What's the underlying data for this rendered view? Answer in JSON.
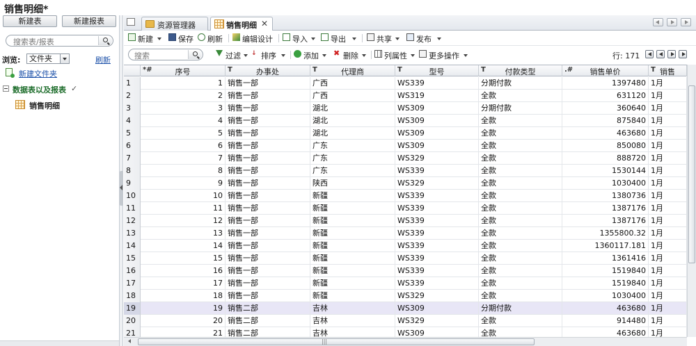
{
  "window": {
    "title": "销售明细*"
  },
  "left": {
    "new_table": "新建表",
    "new_report": "新建报表",
    "search_placeholder": "搜索表/报表",
    "browse_label": "浏览:",
    "browse_value": "文件夹",
    "refresh": "刷新",
    "new_folder": "新建文件夹",
    "tree_root": "数据表以及报表",
    "tree_item": "销售明细"
  },
  "tabs": [
    {
      "label": "资源管理器",
      "icon": "folder-icon"
    },
    {
      "label": "销售明细",
      "icon": "table-icon",
      "close": "✕"
    }
  ],
  "toolbar1": {
    "new": "新建",
    "save": "保存",
    "refresh": "刷新",
    "edit_design": "编辑设计",
    "import": "导入",
    "export": "导出",
    "share": "共享",
    "publish": "发布"
  },
  "toolbar2": {
    "search_placeholder": "搜索",
    "filter": "过滤",
    "sort": "排序",
    "add": "添加",
    "delete": "删除",
    "column_props": "列属性",
    "more_ops": "更多操作",
    "row_count": "行: 171"
  },
  "grid": {
    "columns": [
      {
        "type": "*#",
        "name": "序号"
      },
      {
        "type": "T",
        "name": "办事处"
      },
      {
        "type": "T",
        "name": "代理商"
      },
      {
        "type": "T",
        "name": "型号"
      },
      {
        "type": "T",
        "name": "付款类型"
      },
      {
        "type": ".#",
        "name": "销售单价"
      },
      {
        "type": "T",
        "name": "销售"
      }
    ],
    "rows": [
      [
        "1",
        "1",
        "销售一部",
        "广西",
        "WS339",
        "分期付款",
        "1397480",
        "1月"
      ],
      [
        "2",
        "2",
        "销售一部",
        "广西",
        "WS319",
        "全款",
        "631120",
        "1月"
      ],
      [
        "3",
        "3",
        "销售一部",
        "湖北",
        "WS309",
        "分期付款",
        "360640",
        "1月"
      ],
      [
        "4",
        "4",
        "销售一部",
        "湖北",
        "WS309",
        "全款",
        "875840",
        "1月"
      ],
      [
        "5",
        "5",
        "销售一部",
        "湖北",
        "WS309",
        "全款",
        "463680",
        "1月"
      ],
      [
        "6",
        "6",
        "销售一部",
        "广东",
        "WS309",
        "全款",
        "850080",
        "1月"
      ],
      [
        "7",
        "7",
        "销售一部",
        "广东",
        "WS329",
        "全款",
        "888720",
        "1月"
      ],
      [
        "8",
        "8",
        "销售一部",
        "广东",
        "WS339",
        "全款",
        "1530144",
        "1月"
      ],
      [
        "9",
        "9",
        "销售一部",
        "陕西",
        "WS329",
        "全款",
        "1030400",
        "1月"
      ],
      [
        "10",
        "10",
        "销售一部",
        "新疆",
        "WS339",
        "全款",
        "1380736",
        "1月"
      ],
      [
        "11",
        "11",
        "销售一部",
        "新疆",
        "WS339",
        "全款",
        "1387176",
        "1月"
      ],
      [
        "12",
        "12",
        "销售一部",
        "新疆",
        "WS339",
        "全款",
        "1387176",
        "1月"
      ],
      [
        "13",
        "13",
        "销售一部",
        "新疆",
        "WS339",
        "全款",
        "1355800.32",
        "1月"
      ],
      [
        "14",
        "14",
        "销售一部",
        "新疆",
        "WS339",
        "全款",
        "1360117.181",
        "1月"
      ],
      [
        "15",
        "15",
        "销售一部",
        "新疆",
        "WS339",
        "全款",
        "1361416",
        "1月"
      ],
      [
        "16",
        "16",
        "销售一部",
        "新疆",
        "WS339",
        "全款",
        "1519840",
        "1月"
      ],
      [
        "17",
        "17",
        "销售一部",
        "新疆",
        "WS339",
        "全款",
        "1519840",
        "1月"
      ],
      [
        "18",
        "18",
        "销售一部",
        "新疆",
        "WS329",
        "全款",
        "1030400",
        "1月"
      ],
      [
        "19",
        "19",
        "销售二部",
        "吉林",
        "WS309",
        "分期付款",
        "463680",
        "1月"
      ],
      [
        "20",
        "20",
        "销售二部",
        "吉林",
        "WS329",
        "全款",
        "914480",
        "1月"
      ],
      [
        "21",
        "21",
        "销售二部",
        "吉林",
        "WS309",
        "全款",
        "463680",
        "1月"
      ]
    ],
    "selected_row": 19
  },
  "colors": {
    "link": "#1a4fa8",
    "tree_green": "#1c6c2a",
    "selected_row": "#e8e6f6"
  }
}
